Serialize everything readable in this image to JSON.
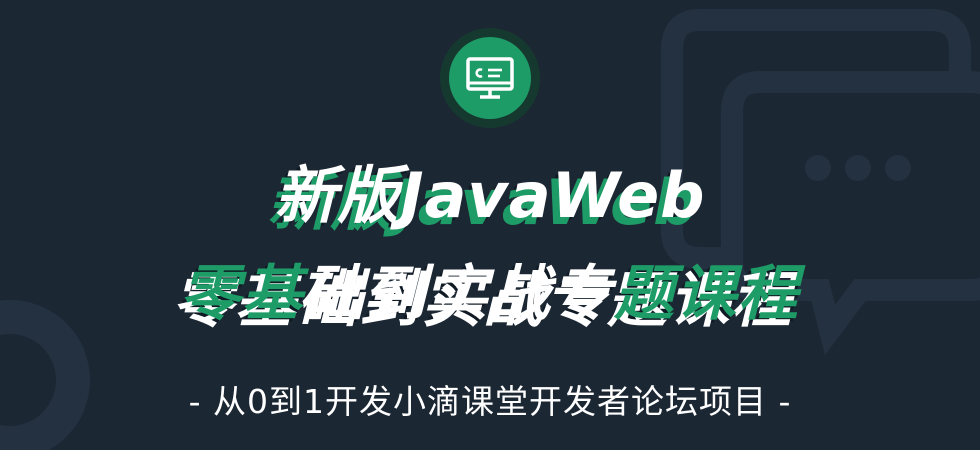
{
  "banner": {
    "icon": "monitor-icon",
    "title_line1_cn": "新版",
    "title_line1_en": "JavaWeb",
    "title_line2_part1": "零基",
    "title_line2_part2": "础到实战专",
    "title_line2_part3": "题课程",
    "subtitle": "- 从0到1开发小滴课堂开发者论坛项目 -",
    "colors": {
      "background": "#1c2734",
      "accent_green": "#1e9c67",
      "text": "#ffffff"
    },
    "decorations": [
      "chat-bubble-icon",
      "circle-ring"
    ]
  }
}
